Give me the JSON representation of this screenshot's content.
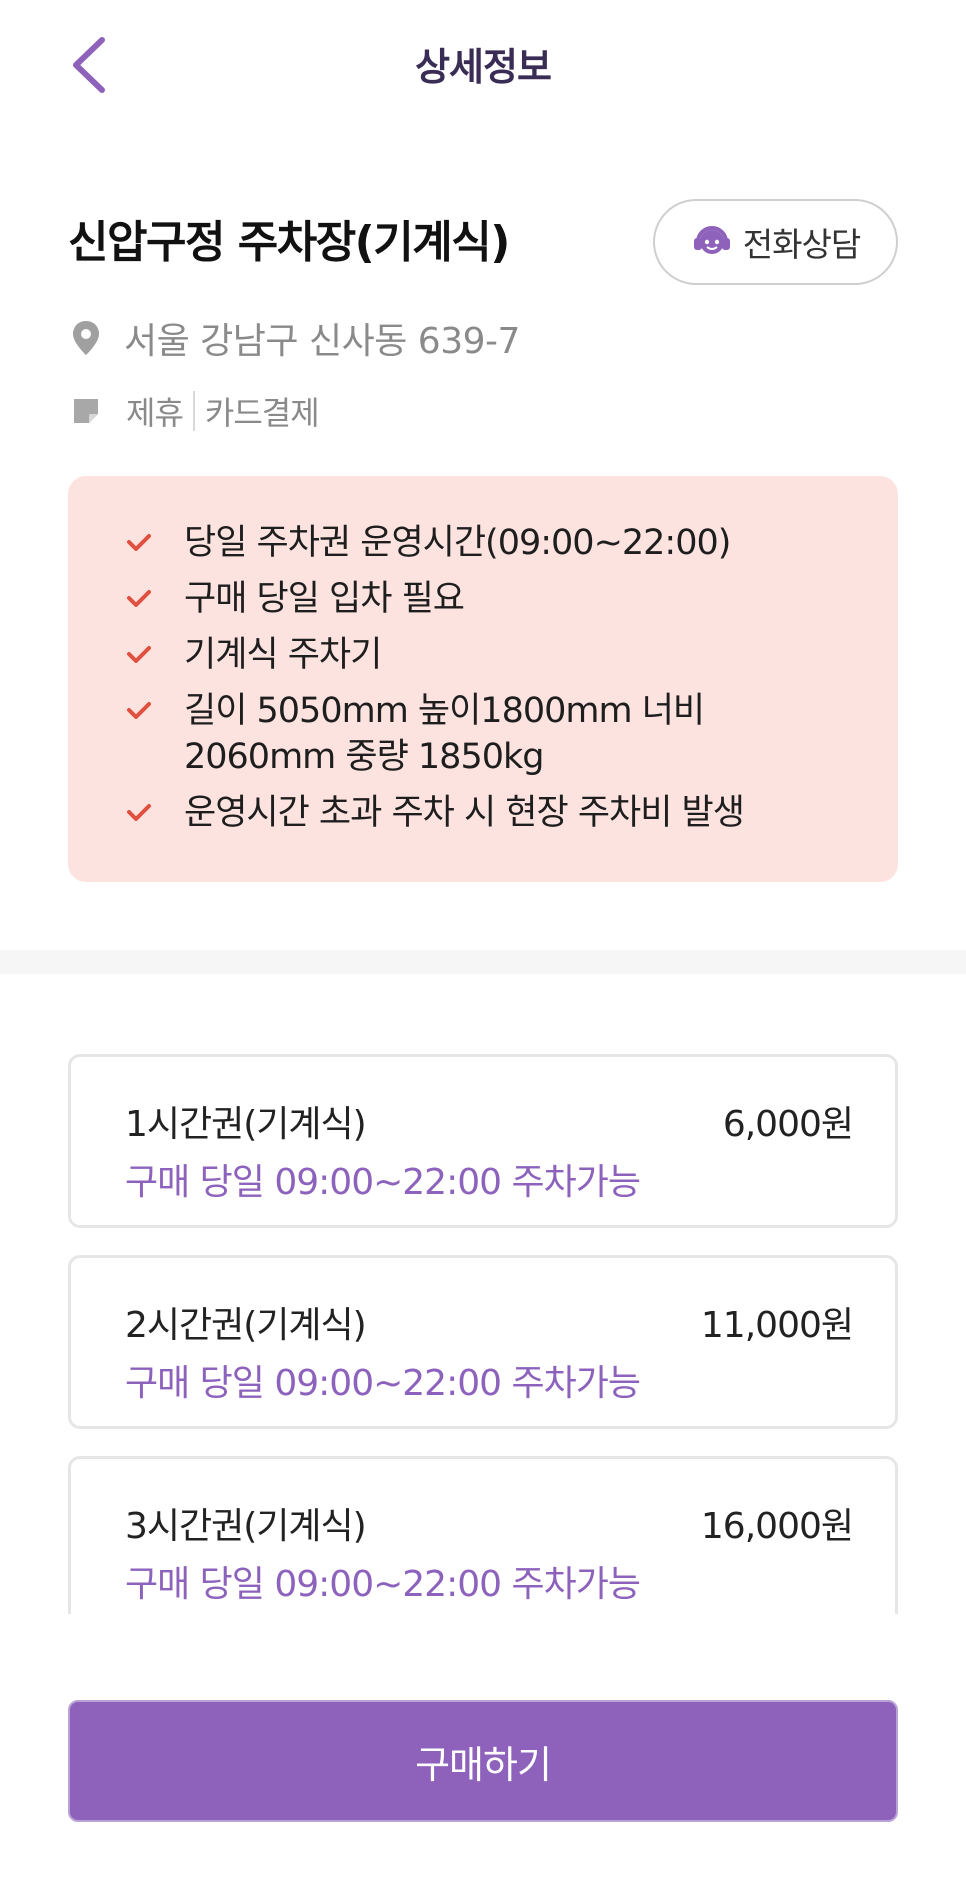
{
  "header": {
    "title": "상세정보",
    "back_icon": "chevron-left-icon"
  },
  "place": {
    "name": "신압구정 주차장(기계식)",
    "call_button_label": "전화상담",
    "call_icon": "headset-icon",
    "address": "서울 강남구 신사동 639-7",
    "address_icon": "location-pin-icon",
    "tags_icon": "sticky-note-icon",
    "tags": [
      "제휴",
      "카드결제"
    ]
  },
  "notice": {
    "items": [
      "당일 주차권 운영시간(09:00~22:00)",
      "구매 당일 입차 필요",
      "기계식 주차기",
      "길이 5050mm 높이1800mm 너비 2060mm 중량 1850kg",
      "운영시간 초과 주차 시 현장 주차비 발생"
    ]
  },
  "tickets": [
    {
      "name": "1시간권(기계식)",
      "price": "6,000원",
      "desc": "구매 당일 09:00~22:00 주차가능"
    },
    {
      "name": "2시간권(기계식)",
      "price": "11,000원",
      "desc": "구매 당일 09:00~22:00 주차가능"
    },
    {
      "name": "3시간권(기계식)",
      "price": "16,000원",
      "desc": "구매 당일 09:00~22:00 주차가능"
    }
  ],
  "purchase": {
    "label": "구매하기"
  },
  "colors": {
    "accent": "#8e62bb",
    "notice_bg": "#fce3e0",
    "check": "#e0503f",
    "title": "#3a2d55"
  }
}
